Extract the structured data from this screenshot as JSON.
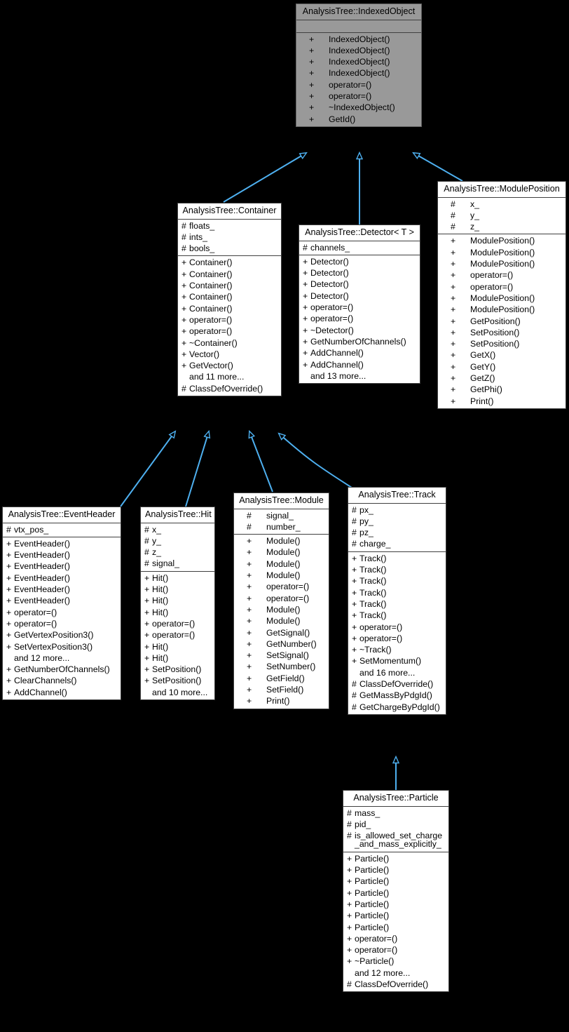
{
  "diagram": {
    "type": "uml-class-inheritance",
    "background_color": "#000000",
    "edge_color": "#4eb0f0",
    "node_fill": "#ffffff",
    "highlight_fill": "#999999",
    "border_color": "#404040"
  },
  "nodes": {
    "indexed_object": {
      "title": "AnalysisTree::IndexedObject",
      "attributes": [],
      "methods": [
        {
          "vis": "+",
          "name": "IndexedObject()"
        },
        {
          "vis": "+",
          "name": "IndexedObject()"
        },
        {
          "vis": "+",
          "name": "IndexedObject()"
        },
        {
          "vis": "+",
          "name": "IndexedObject()"
        },
        {
          "vis": "+",
          "name": "operator=()"
        },
        {
          "vis": "+",
          "name": "operator=()"
        },
        {
          "vis": "+",
          "name": "~IndexedObject()"
        },
        {
          "vis": "+",
          "name": "GetId()"
        }
      ]
    },
    "container": {
      "title": "AnalysisTree::Container",
      "attributes": [
        {
          "vis": "#",
          "name": "floats_"
        },
        {
          "vis": "#",
          "name": "ints_"
        },
        {
          "vis": "#",
          "name": "bools_"
        }
      ],
      "methods": [
        {
          "vis": "+",
          "name": "Container()"
        },
        {
          "vis": "+",
          "name": "Container()"
        },
        {
          "vis": "+",
          "name": "Container()"
        },
        {
          "vis": "+",
          "name": "Container()"
        },
        {
          "vis": "+",
          "name": "Container()"
        },
        {
          "vis": "+",
          "name": "operator=()"
        },
        {
          "vis": "+",
          "name": "operator=()"
        },
        {
          "vis": "+",
          "name": "~Container()"
        },
        {
          "vis": "+",
          "name": "Vector()"
        },
        {
          "vis": "+",
          "name": "GetVector()"
        },
        {
          "vis": "",
          "name": "and 11 more..."
        },
        {
          "vis": "#",
          "name": "ClassDefOverride()"
        }
      ]
    },
    "detector": {
      "title": "AnalysisTree::Detector< T >",
      "attributes": [
        {
          "vis": "#",
          "name": "channels_"
        }
      ],
      "methods": [
        {
          "vis": "+",
          "name": "Detector()"
        },
        {
          "vis": "+",
          "name": "Detector()"
        },
        {
          "vis": "+",
          "name": "Detector()"
        },
        {
          "vis": "+",
          "name": "Detector()"
        },
        {
          "vis": "+",
          "name": "operator=()"
        },
        {
          "vis": "+",
          "name": "operator=()"
        },
        {
          "vis": "+",
          "name": "~Detector()"
        },
        {
          "vis": "+",
          "name": "GetNumberOfChannels()"
        },
        {
          "vis": "+",
          "name": "AddChannel()"
        },
        {
          "vis": "+",
          "name": "AddChannel()"
        },
        {
          "vis": "",
          "name": "and 13 more..."
        }
      ]
    },
    "module_position": {
      "title": "AnalysisTree::ModulePosition",
      "attributes": [
        {
          "vis": "#",
          "name": "x_"
        },
        {
          "vis": "#",
          "name": "y_"
        },
        {
          "vis": "#",
          "name": "z_"
        }
      ],
      "methods": [
        {
          "vis": "+",
          "name": "ModulePosition()"
        },
        {
          "vis": "+",
          "name": "ModulePosition()"
        },
        {
          "vis": "+",
          "name": "ModulePosition()"
        },
        {
          "vis": "+",
          "name": "operator=()"
        },
        {
          "vis": "+",
          "name": "operator=()"
        },
        {
          "vis": "+",
          "name": "ModulePosition()"
        },
        {
          "vis": "+",
          "name": "ModulePosition()"
        },
        {
          "vis": "+",
          "name": "GetPosition()"
        },
        {
          "vis": "+",
          "name": "SetPosition()"
        },
        {
          "vis": "+",
          "name": "SetPosition()"
        },
        {
          "vis": "+",
          "name": "GetX()"
        },
        {
          "vis": "+",
          "name": "GetY()"
        },
        {
          "vis": "+",
          "name": "GetZ()"
        },
        {
          "vis": "+",
          "name": "GetPhi()"
        },
        {
          "vis": "+",
          "name": "Print()"
        }
      ]
    },
    "event_header": {
      "title": "AnalysisTree::EventHeader",
      "attributes": [
        {
          "vis": "#",
          "name": "vtx_pos_"
        }
      ],
      "methods": [
        {
          "vis": "+",
          "name": "EventHeader()"
        },
        {
          "vis": "+",
          "name": "EventHeader()"
        },
        {
          "vis": "+",
          "name": "EventHeader()"
        },
        {
          "vis": "+",
          "name": "EventHeader()"
        },
        {
          "vis": "+",
          "name": "EventHeader()"
        },
        {
          "vis": "+",
          "name": "EventHeader()"
        },
        {
          "vis": "+",
          "name": "operator=()"
        },
        {
          "vis": "+",
          "name": "operator=()"
        },
        {
          "vis": "+",
          "name": "GetVertexPosition3()"
        },
        {
          "vis": "+",
          "name": "SetVertexPosition3()"
        },
        {
          "vis": "",
          "name": "and 12 more..."
        },
        {
          "vis": "+",
          "name": "GetNumberOfChannels()"
        },
        {
          "vis": "+",
          "name": "ClearChannels()"
        },
        {
          "vis": "+",
          "name": "AddChannel()"
        }
      ]
    },
    "hit": {
      "title": "AnalysisTree::Hit",
      "attributes": [
        {
          "vis": "#",
          "name": "x_"
        },
        {
          "vis": "#",
          "name": "y_"
        },
        {
          "vis": "#",
          "name": "z_"
        },
        {
          "vis": "#",
          "name": "signal_"
        }
      ],
      "methods": [
        {
          "vis": "+",
          "name": "Hit()"
        },
        {
          "vis": "+",
          "name": "Hit()"
        },
        {
          "vis": "+",
          "name": "Hit()"
        },
        {
          "vis": "+",
          "name": "Hit()"
        },
        {
          "vis": "+",
          "name": "operator=()"
        },
        {
          "vis": "+",
          "name": "operator=()"
        },
        {
          "vis": "+",
          "name": "Hit()"
        },
        {
          "vis": "+",
          "name": "Hit()"
        },
        {
          "vis": "+",
          "name": "SetPosition()"
        },
        {
          "vis": "+",
          "name": "SetPosition()"
        },
        {
          "vis": "",
          "name": "and 10 more..."
        }
      ]
    },
    "module": {
      "title": "AnalysisTree::Module",
      "attributes": [
        {
          "vis": "#",
          "name": "signal_"
        },
        {
          "vis": "#",
          "name": "number_"
        }
      ],
      "methods": [
        {
          "vis": "+",
          "name": "Module()"
        },
        {
          "vis": "+",
          "name": "Module()"
        },
        {
          "vis": "+",
          "name": "Module()"
        },
        {
          "vis": "+",
          "name": "Module()"
        },
        {
          "vis": "+",
          "name": "operator=()"
        },
        {
          "vis": "+",
          "name": "operator=()"
        },
        {
          "vis": "+",
          "name": "Module()"
        },
        {
          "vis": "+",
          "name": "Module()"
        },
        {
          "vis": "+",
          "name": "GetSignal()"
        },
        {
          "vis": "+",
          "name": "GetNumber()"
        },
        {
          "vis": "+",
          "name": "SetSignal()"
        },
        {
          "vis": "+",
          "name": "SetNumber()"
        },
        {
          "vis": "+",
          "name": "GetField()"
        },
        {
          "vis": "+",
          "name": "SetField()"
        },
        {
          "vis": "+",
          "name": "Print()"
        }
      ]
    },
    "track": {
      "title": "AnalysisTree::Track",
      "attributes": [
        {
          "vis": "#",
          "name": "px_"
        },
        {
          "vis": "#",
          "name": "py_"
        },
        {
          "vis": "#",
          "name": "pz_"
        },
        {
          "vis": "#",
          "name": "charge_"
        }
      ],
      "methods": [
        {
          "vis": "+",
          "name": "Track()"
        },
        {
          "vis": "+",
          "name": "Track()"
        },
        {
          "vis": "+",
          "name": "Track()"
        },
        {
          "vis": "+",
          "name": "Track()"
        },
        {
          "vis": "+",
          "name": "Track()"
        },
        {
          "vis": "+",
          "name": "Track()"
        },
        {
          "vis": "+",
          "name": "operator=()"
        },
        {
          "vis": "+",
          "name": "operator=()"
        },
        {
          "vis": "+",
          "name": "~Track()"
        },
        {
          "vis": "+",
          "name": "SetMomentum()"
        },
        {
          "vis": "",
          "name": "and 16 more..."
        },
        {
          "vis": "#",
          "name": "ClassDefOverride()"
        },
        {
          "vis": "#",
          "name": "GetMassByPdgId()"
        },
        {
          "vis": "#",
          "name": "GetChargeByPdgId()"
        }
      ]
    },
    "particle": {
      "title": "AnalysisTree::Particle",
      "attributes": [
        {
          "vis": "#",
          "name": "mass_"
        },
        {
          "vis": "#",
          "name": "pid_"
        },
        {
          "vis": "#",
          "name": "is_allowed_set_charge",
          "cont": "_and_mass_explicitly_"
        }
      ],
      "methods": [
        {
          "vis": "+",
          "name": "Particle()"
        },
        {
          "vis": "+",
          "name": "Particle()"
        },
        {
          "vis": "+",
          "name": "Particle()"
        },
        {
          "vis": "+",
          "name": "Particle()"
        },
        {
          "vis": "+",
          "name": "Particle()"
        },
        {
          "vis": "+",
          "name": "Particle()"
        },
        {
          "vis": "+",
          "name": "Particle()"
        },
        {
          "vis": "+",
          "name": "operator=()"
        },
        {
          "vis": "+",
          "name": "operator=()"
        },
        {
          "vis": "+",
          "name": "~Particle()"
        },
        {
          "vis": "",
          "name": "and 12 more..."
        },
        {
          "vis": "#",
          "name": "ClassDefOverride()"
        }
      ]
    }
  },
  "edges": [
    {
      "from": "container",
      "to": "indexed_object"
    },
    {
      "from": "detector",
      "to": "indexed_object"
    },
    {
      "from": "module_position",
      "to": "indexed_object"
    },
    {
      "from": "event_header",
      "to": "container"
    },
    {
      "from": "hit",
      "to": "container"
    },
    {
      "from": "module",
      "to": "container"
    },
    {
      "from": "track",
      "to": "container"
    },
    {
      "from": "particle",
      "to": "track"
    }
  ]
}
